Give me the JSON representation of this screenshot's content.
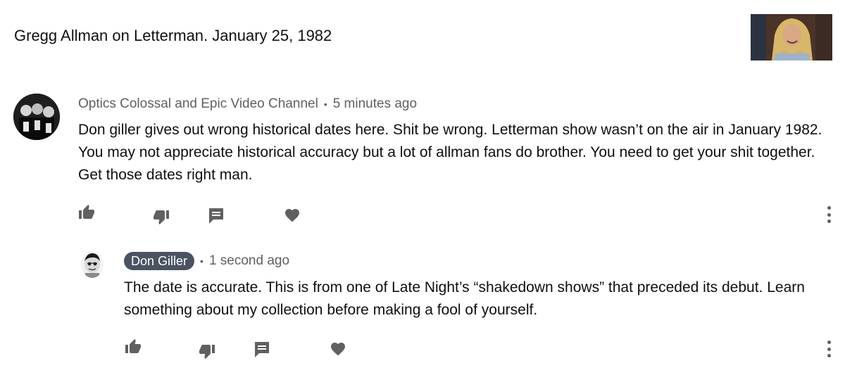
{
  "video": {
    "title": "Gregg Allman on Letterman. January 25, 1982"
  },
  "comment": {
    "author": "Optics Colossal and Epic Video Channel",
    "separator": "•",
    "time": "5 minutes ago",
    "text": "Don giller gives out wrong historical dates here.  Shit be wrong.  Letterman show wasn’t on the air in January 1982.  You may not appreciate historical accuracy but a lot of allman fans do brother.  You need to get your shit together.  Get those dates right man.",
    "actions": [
      "like-icon",
      "dislike-icon",
      "reply-icon",
      "heart-icon",
      "more-vert-icon"
    ]
  },
  "reply": {
    "author": "Don Giller",
    "separator": "•",
    "time": "1 second ago",
    "text": "The date is accurate. This is from one of Late Night’s “shakedown shows” that preceded its debut. Learn something about my collection before making a fool of yourself.",
    "actions": [
      "like-icon",
      "dislike-icon",
      "reply-icon",
      "heart-icon",
      "more-vert-icon"
    ]
  },
  "colors": {
    "icon": "#606060",
    "meta_text": "#606060",
    "author_badge_bg": "#4a5360",
    "author_badge_text": "#ffffff"
  }
}
